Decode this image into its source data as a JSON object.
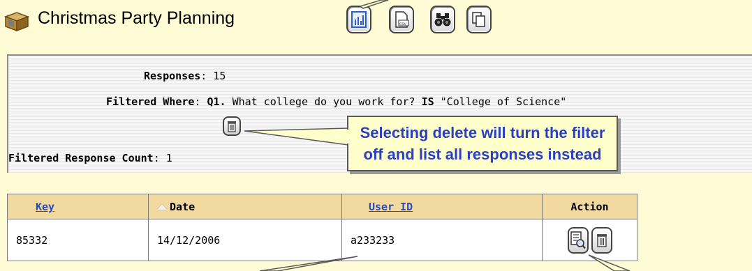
{
  "header": {
    "title": "Christmas Party Planning",
    "icon": "survey-box-icon",
    "toolbar": [
      {
        "name": "chart-button",
        "icon": "bar-chart-icon"
      },
      {
        "name": "export-csv-button",
        "icon": "csv-export-icon"
      },
      {
        "name": "search-button",
        "icon": "binoculars-icon"
      },
      {
        "name": "copy-button",
        "icon": "copy-icon"
      }
    ]
  },
  "summary": {
    "responses_label": "Responses",
    "responses_value": "15",
    "filtered_where_label": "Filtered Where",
    "filter_question_num": "Q1.",
    "filter_question_text": "What college do you work for?",
    "filter_operator": "IS",
    "filter_value": "\"College of Science\"",
    "filtered_count_label": "Filtered Response Count",
    "filtered_count_value": "1",
    "colon": ":"
  },
  "callout": {
    "line1": "Selecting delete will turn the filter",
    "line2": "off and list all responses instead"
  },
  "table": {
    "columns": {
      "key": "Key",
      "date": "Date",
      "user_id": "User ID",
      "action": "Action"
    },
    "rows": [
      {
        "key": "85332",
        "date": "14/12/2006",
        "user_id": "a233233"
      }
    ]
  },
  "colors": {
    "page_bg": "#fffbd4",
    "callout_text": "#2a3fc1",
    "header_bg": "#f2d9a0",
    "link": "#2a4bb8"
  }
}
